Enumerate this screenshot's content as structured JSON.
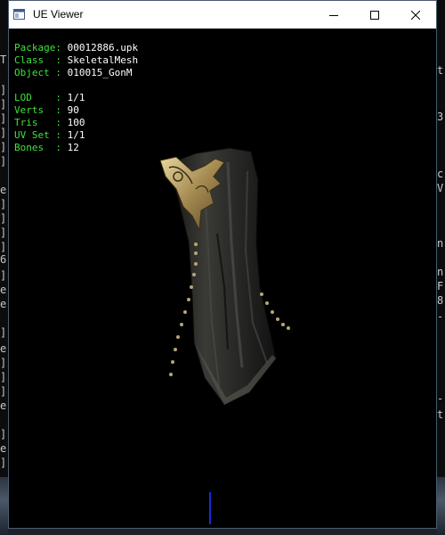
{
  "window": {
    "title": "UE Viewer",
    "controls": {
      "minimize": "minimize-icon",
      "maximize": "maximize-icon",
      "close": "close-icon"
    }
  },
  "info": {
    "package_label": "Package:",
    "package_value": "00012886.upk",
    "class_label": "Class  :",
    "class_value": "SkeletalMesh",
    "object_label": "Object :",
    "object_value": "010015_GonM",
    "lod_label": "LOD    :",
    "lod_value": "1/1",
    "verts_label": "Verts  :",
    "verts_value": "90",
    "tris_label": "Tris   :",
    "tris_value": "100",
    "uvset_label": "UV Set :",
    "uvset_value": "1/1",
    "bones_label": "Bones  :",
    "bones_value": "12"
  },
  "background": {
    "left_chars": [
      "T",
      "]",
      "]",
      "]",
      "]",
      "]",
      "]",
      "e",
      "]",
      "]",
      "]",
      "]",
      "]",
      "6",
      "]",
      "e",
      "e",
      "]",
      "e",
      "]",
      "]",
      "]",
      "e",
      "]",
      "e",
      "]"
    ],
    "right_chars": [
      "t",
      "3",
      "c",
      "V",
      "n",
      "n",
      "F",
      "8",
      "-",
      "-",
      "t",
      "-"
    ]
  },
  "colors": {
    "label": "#3ee23e",
    "value": "#ffffff",
    "viewport": "#000000",
    "axis": "#1a2ad8"
  }
}
